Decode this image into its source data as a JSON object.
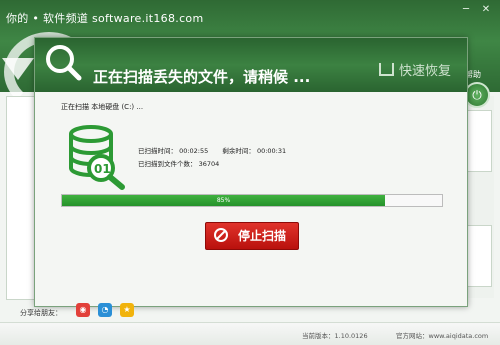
{
  "watermark": "你的 • 软件频道 software.it168.com",
  "help_label": "帮助",
  "dialog": {
    "title": "正在扫描丢失的文件，请稍候 ...",
    "brand": "快速恢复",
    "scan_label": "正在扫描  本地硬盘 (C:) ...",
    "elapsed_label": "已扫描时间：",
    "elapsed_value": "00:02:55",
    "remaining_label": "剩余时间：",
    "remaining_value": "00:00:31",
    "files_label": "已扫描到文件个数：",
    "files_value": "36704",
    "progress_text": "85%",
    "progress_value": 85,
    "stop_button": "停止扫描"
  },
  "share": {
    "label": "分享给朋友：",
    "icons": [
      "weibo-icon",
      "qq-icon",
      "qzone-icon"
    ]
  },
  "footer": {
    "version_label": "当前版本：",
    "version_value": "1.10.0126",
    "site_label": "官方网站：",
    "site_value": "www.aiqidata.com"
  },
  "colors": {
    "header_green": "#3c8242",
    "progress_green": "#25922a",
    "stop_red": "#d0221c"
  }
}
